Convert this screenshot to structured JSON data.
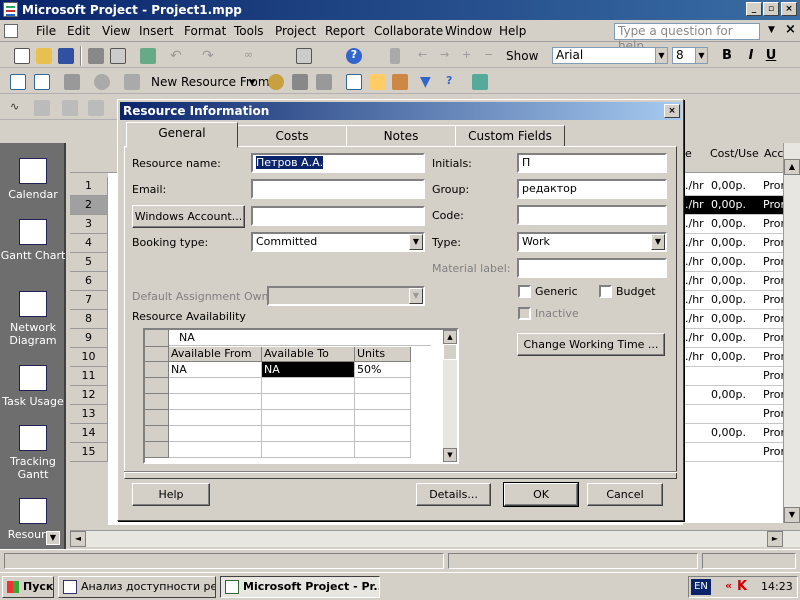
{
  "window": {
    "title": "Microsoft Project - Project1.mpp"
  },
  "menu": [
    "File",
    "Edit",
    "View",
    "Insert",
    "Format",
    "Tools",
    "Project",
    "Report",
    "Collaborate",
    "Window",
    "Help"
  ],
  "help_placeholder": "Type a question for help",
  "toolbar": {
    "show_label": "Show",
    "font": "Arial",
    "font_size": "8",
    "bold": "B",
    "italic": "I",
    "underline": "U",
    "new_resource_from": "New Resource From"
  },
  "view_bar": [
    "Calendar",
    "Gantt Chart",
    "Network Diagram",
    "Task Usage",
    "Tracking Gantt",
    "Resource Sheet"
  ],
  "grid": {
    "row_numbers": [
      "1",
      "2",
      "3",
      "4",
      "5",
      "6",
      "7",
      "8",
      "9",
      "10",
      "11",
      "12",
      "13",
      "14",
      "15"
    ],
    "headers": {
      "rate": "e",
      "cost_use": "Cost/Use",
      "accrue": "Acc"
    },
    "rows": [
      {
        "rate": "./hr",
        "cost": "0,00р.",
        "acc": "Pror"
      },
      {
        "rate": "./hr",
        "cost": "0,00р.",
        "acc": "Pror"
      },
      {
        "rate": "./hr",
        "cost": "0,00р.",
        "acc": "Pror"
      },
      {
        "rate": "./hr",
        "cost": "0,00р.",
        "acc": "Pror"
      },
      {
        "rate": "./hr",
        "cost": "0,00р.",
        "acc": "Pror"
      },
      {
        "rate": "./hr",
        "cost": "0,00р.",
        "acc": "Pror"
      },
      {
        "rate": "./hr",
        "cost": "0,00р.",
        "acc": "Pror"
      },
      {
        "rate": "./hr",
        "cost": "0,00р.",
        "acc": "Pror"
      },
      {
        "rate": "./hr",
        "cost": "0,00р.",
        "acc": "Pror"
      },
      {
        "rate": "./hr",
        "cost": "0,00р.",
        "acc": "Pror"
      },
      {
        "rate": "",
        "cost": "",
        "acc": "Pror"
      },
      {
        "rate": "",
        "cost": "0,00р.",
        "acc": "Pror"
      },
      {
        "rate": "",
        "cost": "",
        "acc": "Pror"
      },
      {
        "rate": "",
        "cost": "0,00р.",
        "acc": "Pror"
      },
      {
        "rate": "",
        "cost": "",
        "acc": "Pror"
      }
    ]
  },
  "dialog": {
    "title": "Resource Information",
    "tabs": [
      "General",
      "Costs",
      "Notes",
      "Custom Fields"
    ],
    "labels": {
      "resource_name": "Resource name:",
      "email": "Email:",
      "windows_account": "Windows Account...",
      "booking_type": "Booking type:",
      "default_owner": "Default Assignment Owner:",
      "resource_availability": "Resource Availability",
      "initials": "Initials:",
      "group": "Group:",
      "code": "Code:",
      "type": "Type:",
      "material_label": "Material label:",
      "generic": "Generic",
      "budget": "Budget",
      "inactive": "Inactive",
      "change_working_time": "Change Working Time ..."
    },
    "values": {
      "resource_name": "Петров А.А.",
      "email": "",
      "windows_account": "",
      "booking_type": "Committed",
      "default_owner": "",
      "initials": "П",
      "group": "редактор",
      "code": "",
      "type": "Work",
      "material_label": ""
    },
    "availability": {
      "edit_value": "NA",
      "columns": [
        "Available From",
        "Available To",
        "Units"
      ],
      "rows": [
        [
          "NA",
          "NA",
          "50%"
        ]
      ]
    },
    "buttons": {
      "help": "Help",
      "details": "Details...",
      "ok": "OK",
      "cancel": "Cancel"
    }
  },
  "taskbar": {
    "start": "Пуск",
    "tasks": [
      "Анализ доступности ре...",
      "Microsoft Project - Pr..."
    ],
    "lang": "EN",
    "time": "14:23"
  }
}
